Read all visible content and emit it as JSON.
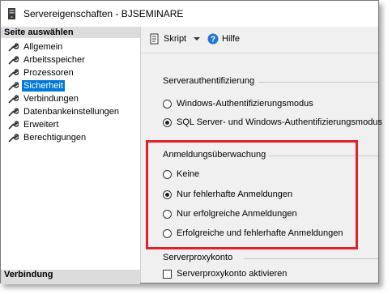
{
  "window": {
    "title": "Servereigenschaften - BJSEMINARE"
  },
  "sidebar": {
    "header": "Seite auswählen",
    "items": [
      {
        "label": "Allgemein",
        "icon": "wrench-icon",
        "selected": false
      },
      {
        "label": "Arbeitsspeicher",
        "icon": "wrench-icon",
        "selected": false
      },
      {
        "label": "Prozessoren",
        "icon": "wrench-icon",
        "selected": false
      },
      {
        "label": "Sicherheit",
        "icon": "wrench-icon",
        "selected": true
      },
      {
        "label": "Verbindungen",
        "icon": "wrench-icon",
        "selected": false
      },
      {
        "label": "Datenbankeinstellungen",
        "icon": "wrench-icon",
        "selected": false
      },
      {
        "label": "Erweitert",
        "icon": "wrench-icon",
        "selected": false
      },
      {
        "label": "Berechtigungen",
        "icon": "wrench-icon",
        "selected": false
      }
    ],
    "footer": "Verbindung"
  },
  "toolbar": {
    "script_label": "Skript",
    "help_label": "Hilfe"
  },
  "server_auth": {
    "title": "Serverauthentifizierung",
    "options": [
      {
        "label": "Windows-Authentifizierungsmodus",
        "checked": false
      },
      {
        "label": "SQL Server- und Windows-Authentifizierungsmodus",
        "checked": true
      }
    ]
  },
  "login_audit": {
    "title": "Anmeldungsüberwachung",
    "options": [
      {
        "label": "Keine",
        "checked": false
      },
      {
        "label": "Nur fehlerhafte Anmeldungen",
        "checked": true
      },
      {
        "label": "Nur erfolgreiche Anmeldungen",
        "checked": false
      },
      {
        "label": "Erfolgreiche und fehlerhafte Anmeldungen",
        "checked": false
      }
    ]
  },
  "proxy": {
    "title": "Serverproxykonto",
    "checkbox_label": "Serverproxykonto aktivieren",
    "checked": false
  },
  "colors": {
    "selection": "#0078d7",
    "highlight": "#e0202a"
  }
}
